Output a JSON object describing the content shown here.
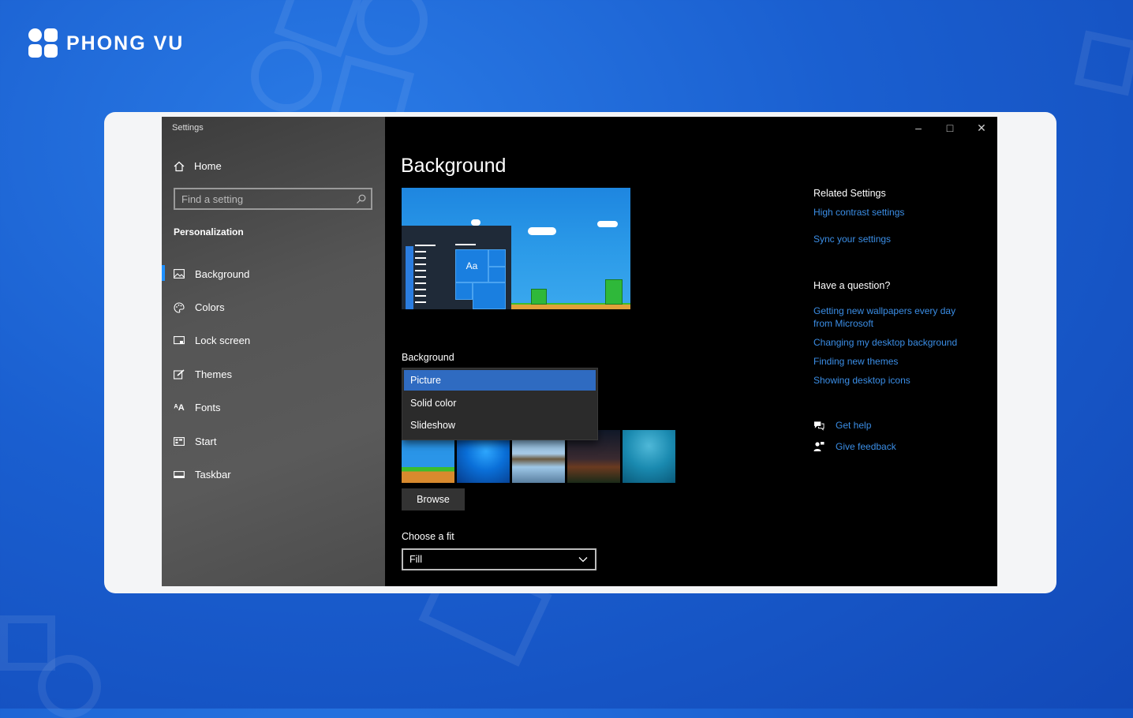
{
  "brand": {
    "name": "PHONG VU"
  },
  "window": {
    "title": "Settings",
    "controls": {
      "minimize": "–",
      "maximize": "□",
      "close": "✕"
    }
  },
  "sidebar": {
    "home": "Home",
    "search_placeholder": "Find a setting",
    "section": "Personalization",
    "items": [
      {
        "label": "Background",
        "icon": "picture-icon",
        "active": true
      },
      {
        "label": "Colors",
        "icon": "palette-icon"
      },
      {
        "label": "Lock screen",
        "icon": "lock-screen-icon"
      },
      {
        "label": "Themes",
        "icon": "themes-brush-icon"
      },
      {
        "label": "Fonts",
        "icon": "fonts-icon"
      },
      {
        "label": "Start",
        "icon": "start-icon"
      },
      {
        "label": "Taskbar",
        "icon": "taskbar-icon"
      }
    ]
  },
  "main": {
    "title": "Background",
    "preview": {
      "tile_text": "Aa"
    },
    "background_label": "Background",
    "dropdown_options": [
      "Picture",
      "Solid color",
      "Slideshow"
    ],
    "selected_option": "Picture",
    "browse": "Browse",
    "fit_label": "Choose a fit",
    "fit_value": "Fill"
  },
  "right": {
    "related_title": "Related Settings",
    "related_links": [
      "High contrast settings",
      "Sync your settings"
    ],
    "question_title": "Have a question?",
    "question_links": [
      "Getting new wallpapers every day from Microsoft",
      "Changing my desktop background",
      "Finding new themes",
      "Showing desktop icons"
    ],
    "get_help": "Get help",
    "give_feedback": "Give feedback"
  },
  "colors": {
    "accent": "#2f6bc1",
    "link": "#3b8ee6",
    "page_bg": "#1a5fd0"
  }
}
